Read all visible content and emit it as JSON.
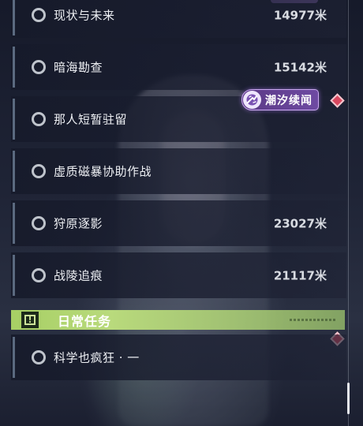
{
  "quests": [
    {
      "name": "现状与未来",
      "distance": "14977米"
    },
    {
      "name": "暗海勘查",
      "distance": "15142米"
    },
    {
      "name": "那人短暂驻留",
      "distance": ""
    },
    {
      "name": "虚质磁暴协助作战",
      "distance": ""
    },
    {
      "name": "狩原逐影",
      "distance": "23027米"
    },
    {
      "name": "战陵追痕",
      "distance": "21117米"
    }
  ],
  "tag": {
    "label": "潮汐续闻"
  },
  "section": {
    "title": "日常任务",
    "icon": "!"
  },
  "daily_quests": [
    {
      "name": "科学也疯狂 · 一",
      "distance": ""
    }
  ],
  "colors": {
    "section_accent": "#a7cf64",
    "tag_accent": "#6e4aa2",
    "marker": "#d9475f"
  }
}
